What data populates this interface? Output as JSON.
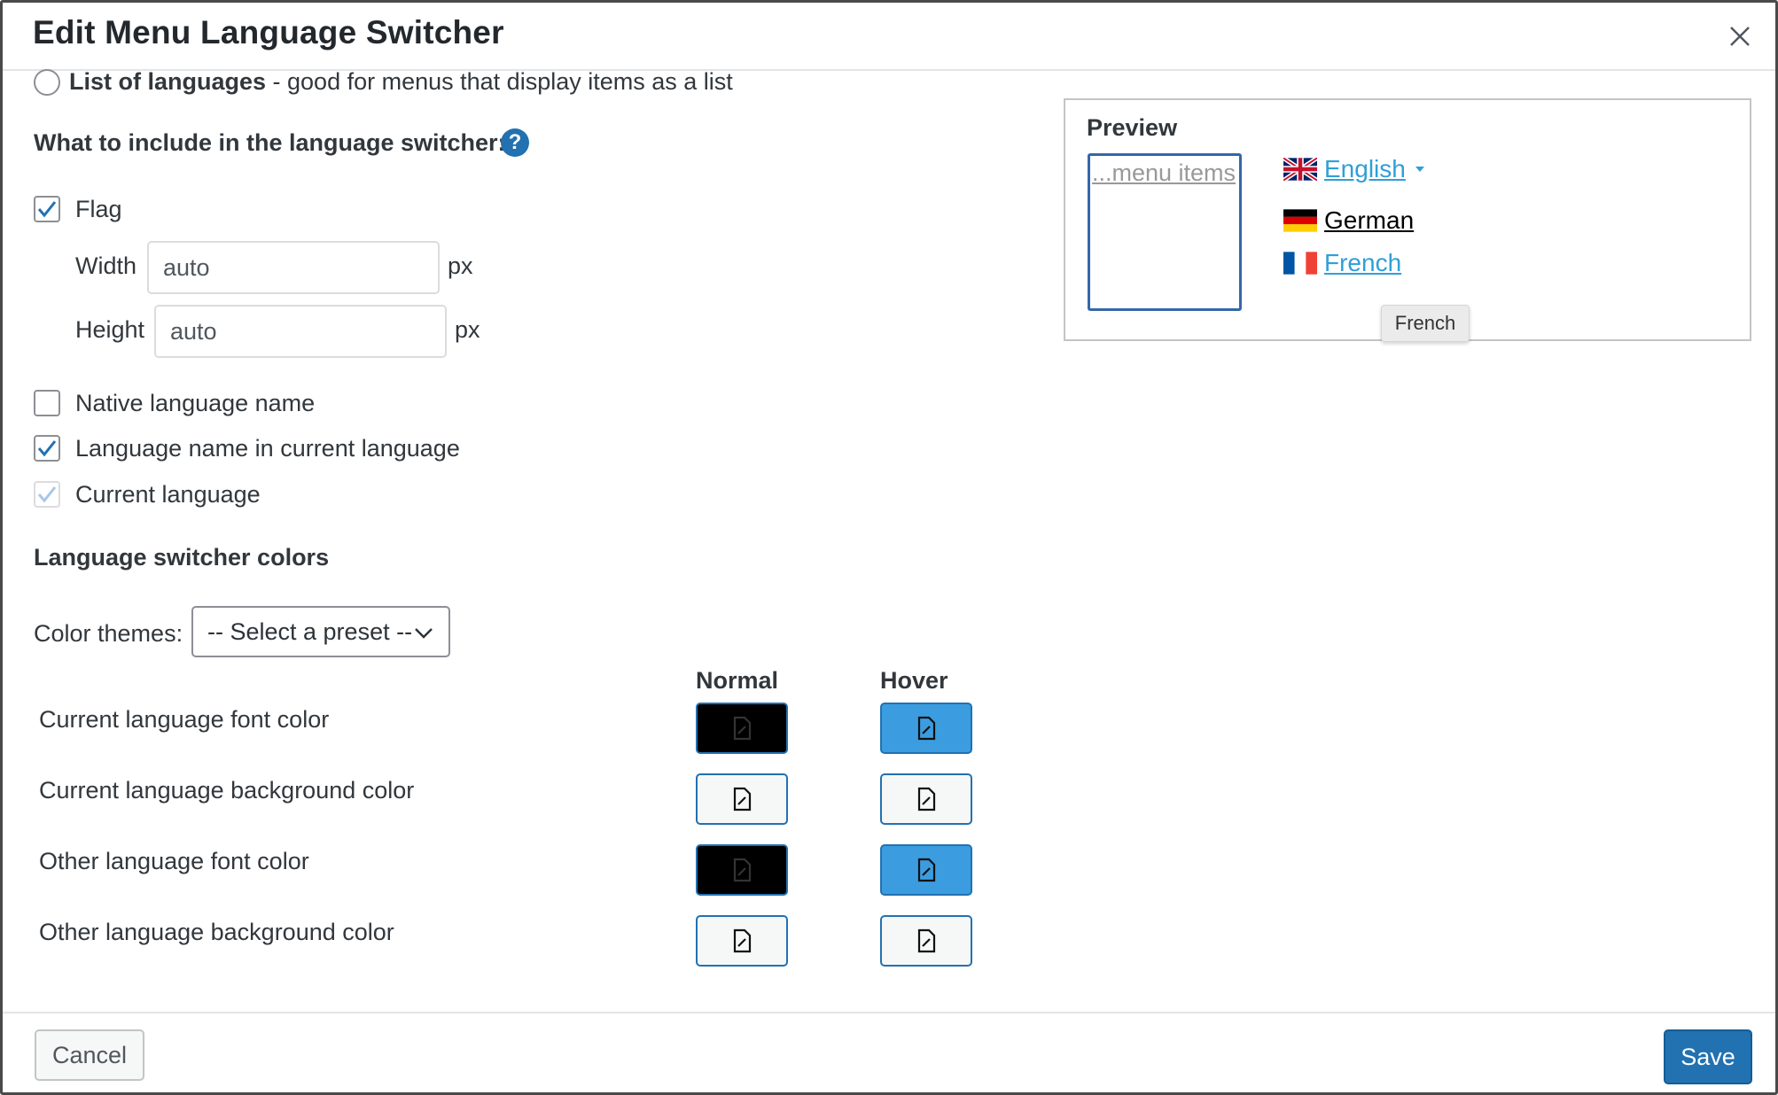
{
  "dialog": {
    "title": "Edit Menu Language Switcher"
  },
  "layout_option": {
    "bold_label": "List of languages",
    "description": " - good for menus that display items as a list",
    "selected": false
  },
  "include_section": {
    "heading": "What to include in the language switcher:",
    "help_glyph": "?",
    "flag": {
      "label": "Flag",
      "checked": true
    },
    "width": {
      "label": "Width",
      "value": "auto",
      "unit": "px"
    },
    "height": {
      "label": "Height",
      "value": "auto",
      "unit": "px"
    },
    "native_name": {
      "label": "Native language name",
      "checked": false
    },
    "name_current": {
      "label": "Language name in current language",
      "checked": true
    },
    "current_language": {
      "label": "Current language",
      "checked": true,
      "disabled": true
    }
  },
  "colors_section": {
    "heading": "Language switcher colors",
    "themes_label": "Color themes:",
    "preset_value": "-- Select a preset --",
    "col_normal": "Normal",
    "col_hover": "Hover",
    "rows": [
      {
        "label": "Current language font color",
        "normal": "#000000",
        "hover": "#3b9de0"
      },
      {
        "label": "Current language background color",
        "normal": "#f6f7f7",
        "hover": "#f6f7f7"
      },
      {
        "label": "Other language font color",
        "normal": "#000000",
        "hover": "#3b9de0"
      },
      {
        "label": "Other language background color",
        "normal": "#f6f7f7",
        "hover": "#f6f7f7"
      }
    ]
  },
  "preview": {
    "heading": "Preview",
    "menu_placeholder": "...menu items",
    "languages": [
      {
        "name": "English",
        "flag": "uk-flag-icon",
        "color": "#2f9fd8",
        "dropdown": true
      },
      {
        "name": "German",
        "flag": "germany-flag-icon",
        "color": "#000000"
      },
      {
        "name": "French",
        "flag": "france-flag-icon",
        "color": "#2f9fd8"
      }
    ],
    "tooltip": "French"
  },
  "footer": {
    "cancel_label": "Cancel",
    "save_label": "Save"
  }
}
